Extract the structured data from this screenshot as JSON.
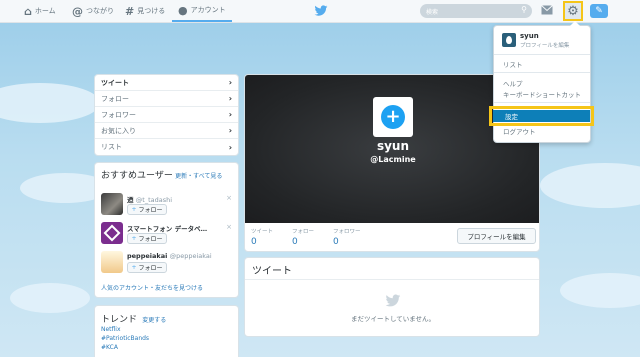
{
  "nav": {
    "home": "ホーム",
    "connect": "つながり",
    "discover": "見つける",
    "account": "アカウント",
    "search_placeholder": "検索"
  },
  "profile": {
    "name": "syun",
    "handle": "@Lacmine",
    "stats": [
      {
        "label": "ツイート",
        "value": "0"
      },
      {
        "label": "フォロー",
        "value": "0"
      },
      {
        "label": "フォロワー",
        "value": "0"
      }
    ],
    "edit_button": "プロフィールを編集"
  },
  "side_menu": {
    "items": [
      {
        "label": "ツイート",
        "active": true
      },
      {
        "label": "フォロー",
        "active": false
      },
      {
        "label": "フォロワー",
        "active": false
      },
      {
        "label": "お気に入り",
        "active": false
      },
      {
        "label": "リスト",
        "active": false
      }
    ]
  },
  "recommend": {
    "title": "おすすめユーザー",
    "refresh": "更新",
    "sep": "・",
    "view_all": "すべて見る",
    "follow_label": "フォロー",
    "users": [
      {
        "name": "迺",
        "handle": "@t_tadashi"
      },
      {
        "name": "スマートフォン データベ…",
        "handle": ""
      },
      {
        "name": "peppeiakai",
        "handle": "@peppeiakai"
      }
    ],
    "footer_popular": "人気のアカウント",
    "footer_sep": "・",
    "footer_find": "友だちを見つける"
  },
  "trends": {
    "title": "トレンド",
    "change": "変更する",
    "items": [
      "Netflix",
      "#PatrioticBands",
      "#KCA"
    ]
  },
  "tweets": {
    "title": "ツイート",
    "empty": "まだツイートしていません。"
  },
  "dropdown": {
    "user_name": "syun",
    "user_sub": "プロフィールを編集",
    "list": "リスト",
    "help": "ヘルプ",
    "shortcuts": "キーボードショートカット",
    "settings": "設定",
    "logout": "ログアウト"
  },
  "colors": {
    "accent": "#55acee",
    "highlight": "#f5c518",
    "selected": "#0d7fb8"
  }
}
